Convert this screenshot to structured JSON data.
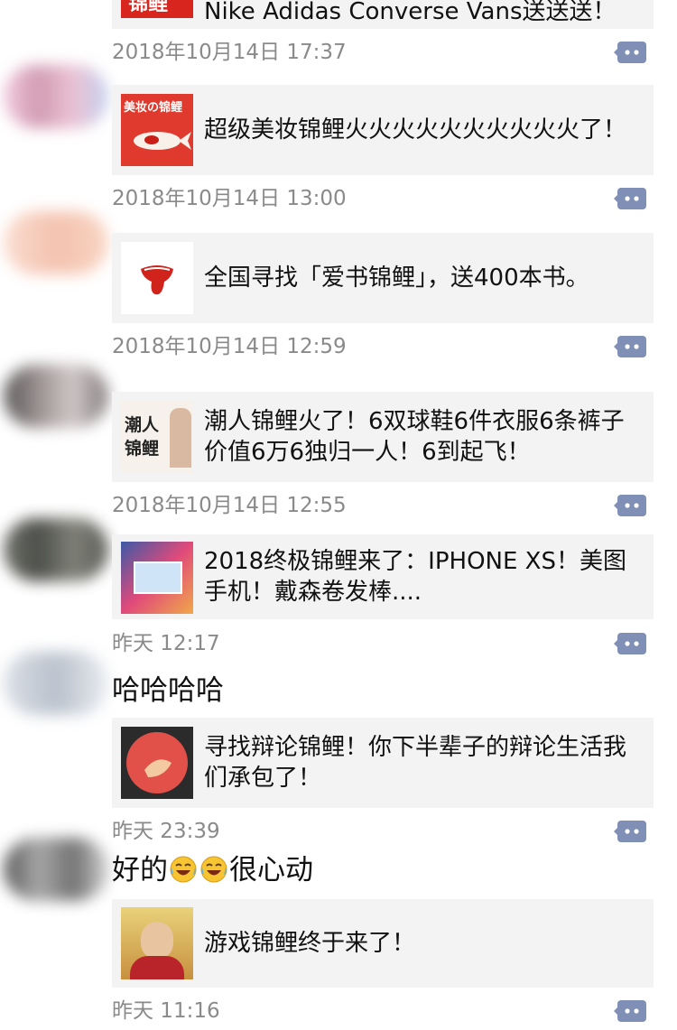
{
  "posts": [
    {
      "card_text": "Nike Adidas Converse Vans送送送！",
      "thumb_label": "锦鲤",
      "time": "2018年10月14日 17:37"
    },
    {
      "card_text": "超级美妆锦鲤火火火火火火火火火火了！",
      "thumb_label": "美妆の锦鲤",
      "time": "2018年10月14日 13:00"
    },
    {
      "card_text": "全国寻找「爱书锦鲤」，送400本书。",
      "time": "2018年10月14日 12:59"
    },
    {
      "card_text": "潮人锦鲤火了！6双球鞋6件衣服6条裤子价值6万6独归一人！6到起飞！",
      "thumb_label": "潮人 锦鲤",
      "time": "2018年10月14日 12:55"
    },
    {
      "card_text": "2018终极锦鲤来了：IPHONE XS！美图手机！戴森卷发棒....",
      "time": "昨天 12:17"
    },
    {
      "comment": "哈哈哈哈",
      "card_text": "寻找辩论锦鲤！你下半辈子的辩论生活我们承包了！",
      "time": "昨天 23:39"
    },
    {
      "comment_before": "好的",
      "comment_after": "很心动",
      "card_text": "游戏锦鲤终于来了！",
      "time": "昨天 11:16"
    }
  ],
  "colors": {
    "card_background": "#f3f3f3",
    "time_text": "#8a8a8a",
    "comment_icon": "#7f8fb5"
  },
  "icons": {
    "comment": "comment-icon",
    "emoji": "laughing-tears-emoji-icon"
  }
}
